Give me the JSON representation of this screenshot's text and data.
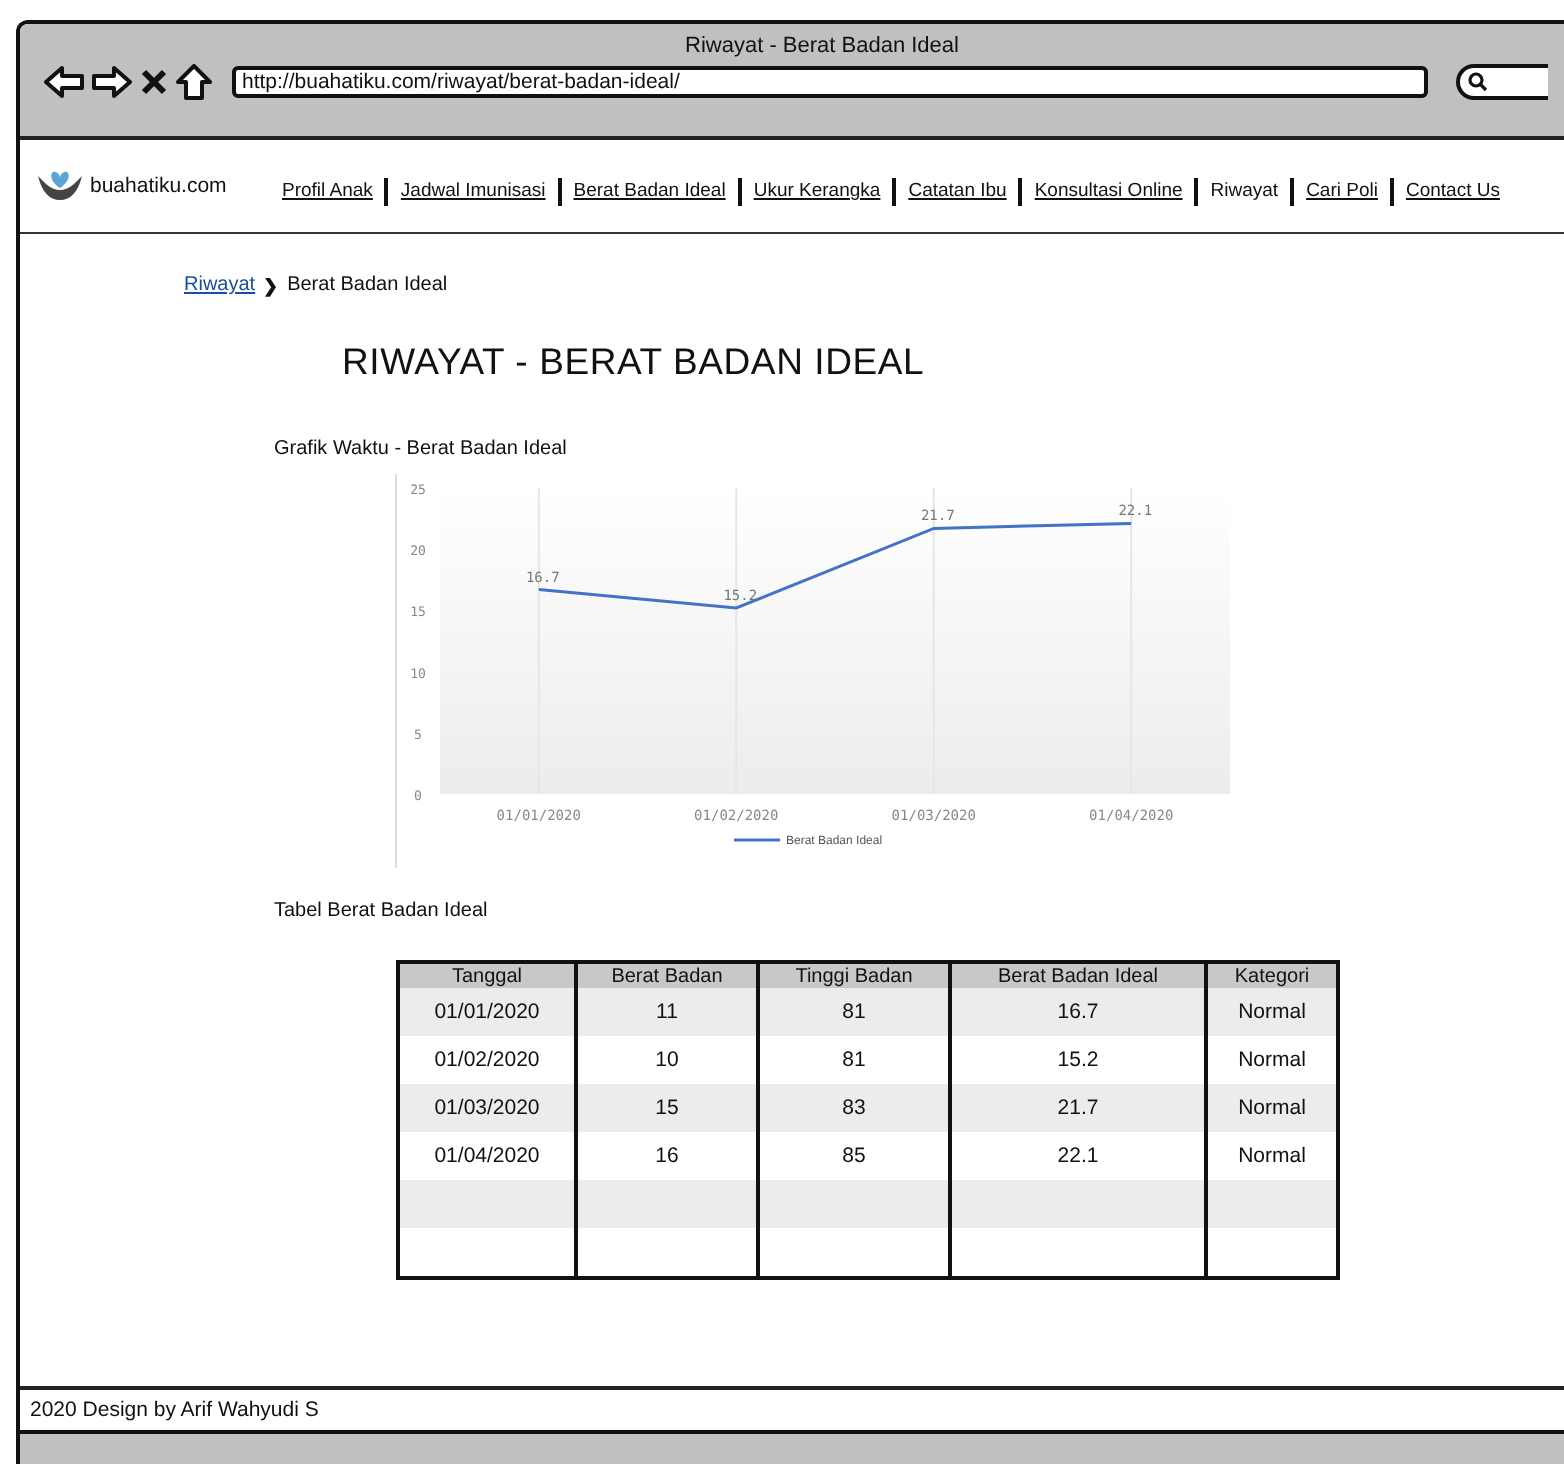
{
  "window": {
    "title": "Riwayat - Berat Badan Ideal",
    "address": "http://buahatiku.com/riwayat/berat-badan-ideal/"
  },
  "site": {
    "logo_text": "buahatiku.com"
  },
  "nav": [
    {
      "label": "Profil Anak",
      "selected": false
    },
    {
      "label": "Jadwal Imunisasi",
      "selected": false
    },
    {
      "label": "Berat Badan Ideal",
      "selected": false
    },
    {
      "label": "Ukur Kerangka",
      "selected": false
    },
    {
      "label": "Catatan Ibu",
      "selected": false
    },
    {
      "label": "Konsultasi Online",
      "selected": false
    },
    {
      "label": "Riwayat",
      "selected": true
    },
    {
      "label": "Cari Poli",
      "selected": false
    },
    {
      "label": "Contact Us",
      "selected": false
    }
  ],
  "breadcrumb": {
    "link": "Riwayat",
    "separator": "❯",
    "current": "Berat Badan Ideal"
  },
  "heading": "RIWAYAT - BERAT BADAN IDEAL",
  "chart_section": {
    "title": "Grafik Waktu - Berat Badan Ideal",
    "chart_data": {
      "type": "line",
      "categories": [
        "01/01/2020",
        "01/02/2020",
        "01/03/2020",
        "01/04/2020"
      ],
      "series": [
        {
          "name": "Berat Badan Ideal",
          "color": "#4472c4",
          "values": [
            16.7,
            15.2,
            21.7,
            22.1
          ]
        }
      ],
      "ylim": [
        0,
        25
      ],
      "grid": true,
      "yticks": [
        0,
        5,
        10,
        15,
        20,
        25
      ],
      "data_labels": true
    }
  },
  "table_section": {
    "title": "Tabel Berat Badan Ideal",
    "columns": [
      "Tanggal",
      "Berat Badan",
      "Tinggi Badan",
      "Berat Badan Ideal",
      "Kategori"
    ],
    "rows": [
      [
        "01/01/2020",
        "11",
        "81",
        "16.7",
        "Normal"
      ],
      [
        "01/02/2020",
        "10",
        "81",
        "15.2",
        "Normal"
      ],
      [
        "01/03/2020",
        "15",
        "83",
        "21.7",
        "Normal"
      ],
      [
        "01/04/2020",
        "16",
        "85",
        "22.1",
        "Normal"
      ]
    ]
  },
  "footer": "2020 Design by Arif Wahyudi S"
}
